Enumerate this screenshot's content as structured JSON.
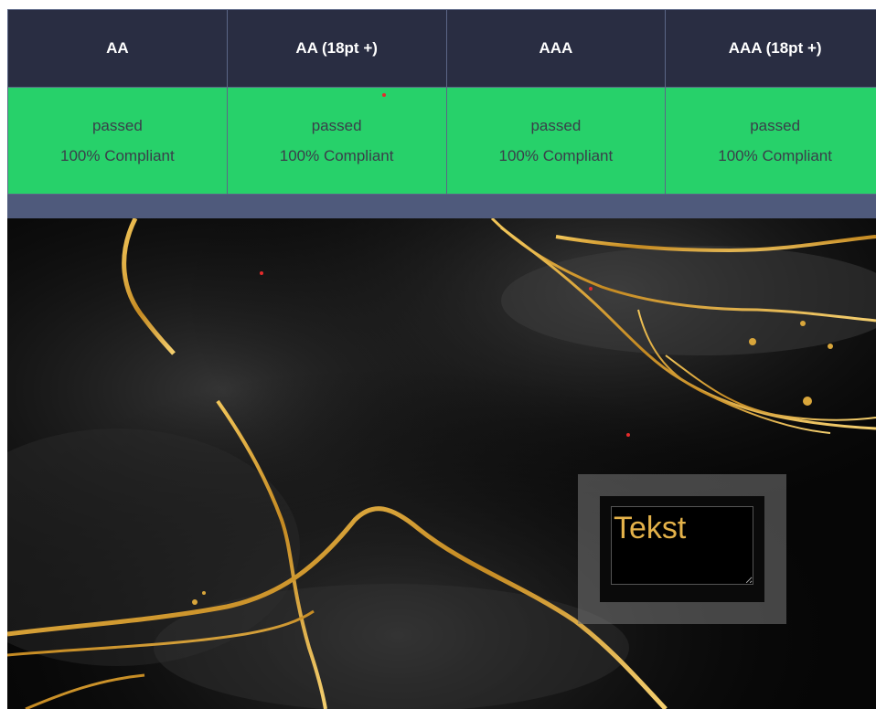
{
  "table": {
    "headers": [
      "AA",
      "AA (18pt +)",
      "AAA",
      "AAA (18pt +)"
    ],
    "rows": [
      [
        {
          "status": "passed",
          "compliance": "100% Compliant"
        },
        {
          "status": "passed",
          "compliance": "100% Compliant"
        },
        {
          "status": "passed",
          "compliance": "100% Compliant"
        },
        {
          "status": "passed",
          "compliance": "100% Compliant"
        }
      ]
    ]
  },
  "textbox": {
    "value": "Tekst"
  },
  "colors": {
    "header_bg": "#292d42",
    "pass_bg": "#27d16a",
    "band_bg": "#4f5a7c",
    "text_gold": "#e4b24a"
  }
}
